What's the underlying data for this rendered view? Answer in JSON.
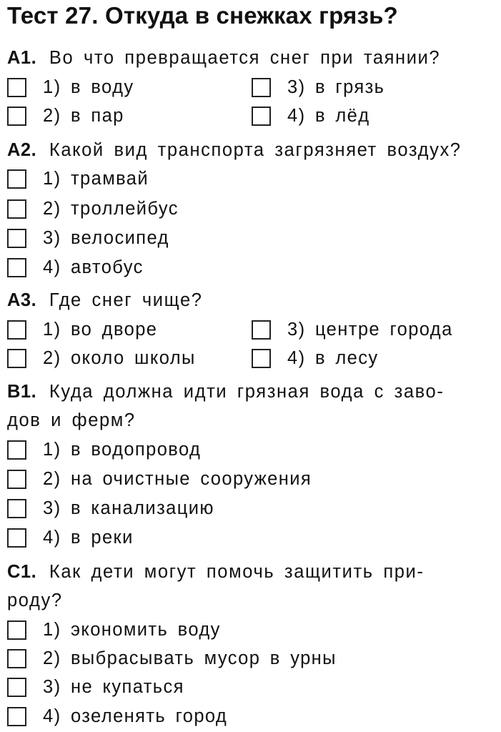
{
  "title": "Тест 27. Откуда в снежках грязь?",
  "questions": [
    {
      "id": "A1.",
      "text_lines": [
        "Во что превращается снег при таянии?"
      ],
      "options": [
        "1) в воду",
        "2) в пар",
        "3) в грязь",
        "4) в лёд"
      ]
    },
    {
      "id": "A2.",
      "text_lines": [
        "Какой вид транспорта загрязняет воздух?"
      ],
      "options": [
        "1) трамвай",
        "2) троллейбус",
        "3) велосипед",
        "4) автобус"
      ]
    },
    {
      "id": "A3.",
      "text_lines": [
        "Где снег чище?"
      ],
      "options": [
        "1) во дворе",
        "2) около школы",
        "3) центре города",
        "4) в лесу"
      ]
    },
    {
      "id": "B1.",
      "text_lines": [
        "Куда должна идти грязная вода с заво-",
        "дов и ферм?"
      ],
      "options": [
        "1) в водопровод",
        "2) на очистные сооружения",
        "3) в канализацию",
        "4) в реки"
      ]
    },
    {
      "id": "C1.",
      "text_lines": [
        "Как дети могут помочь защитить при-",
        "роду?"
      ],
      "options": [
        "1) экономить воду",
        "2) выбрасывать мусор в урны",
        "3) не купаться",
        "4) озеленять город"
      ]
    }
  ]
}
